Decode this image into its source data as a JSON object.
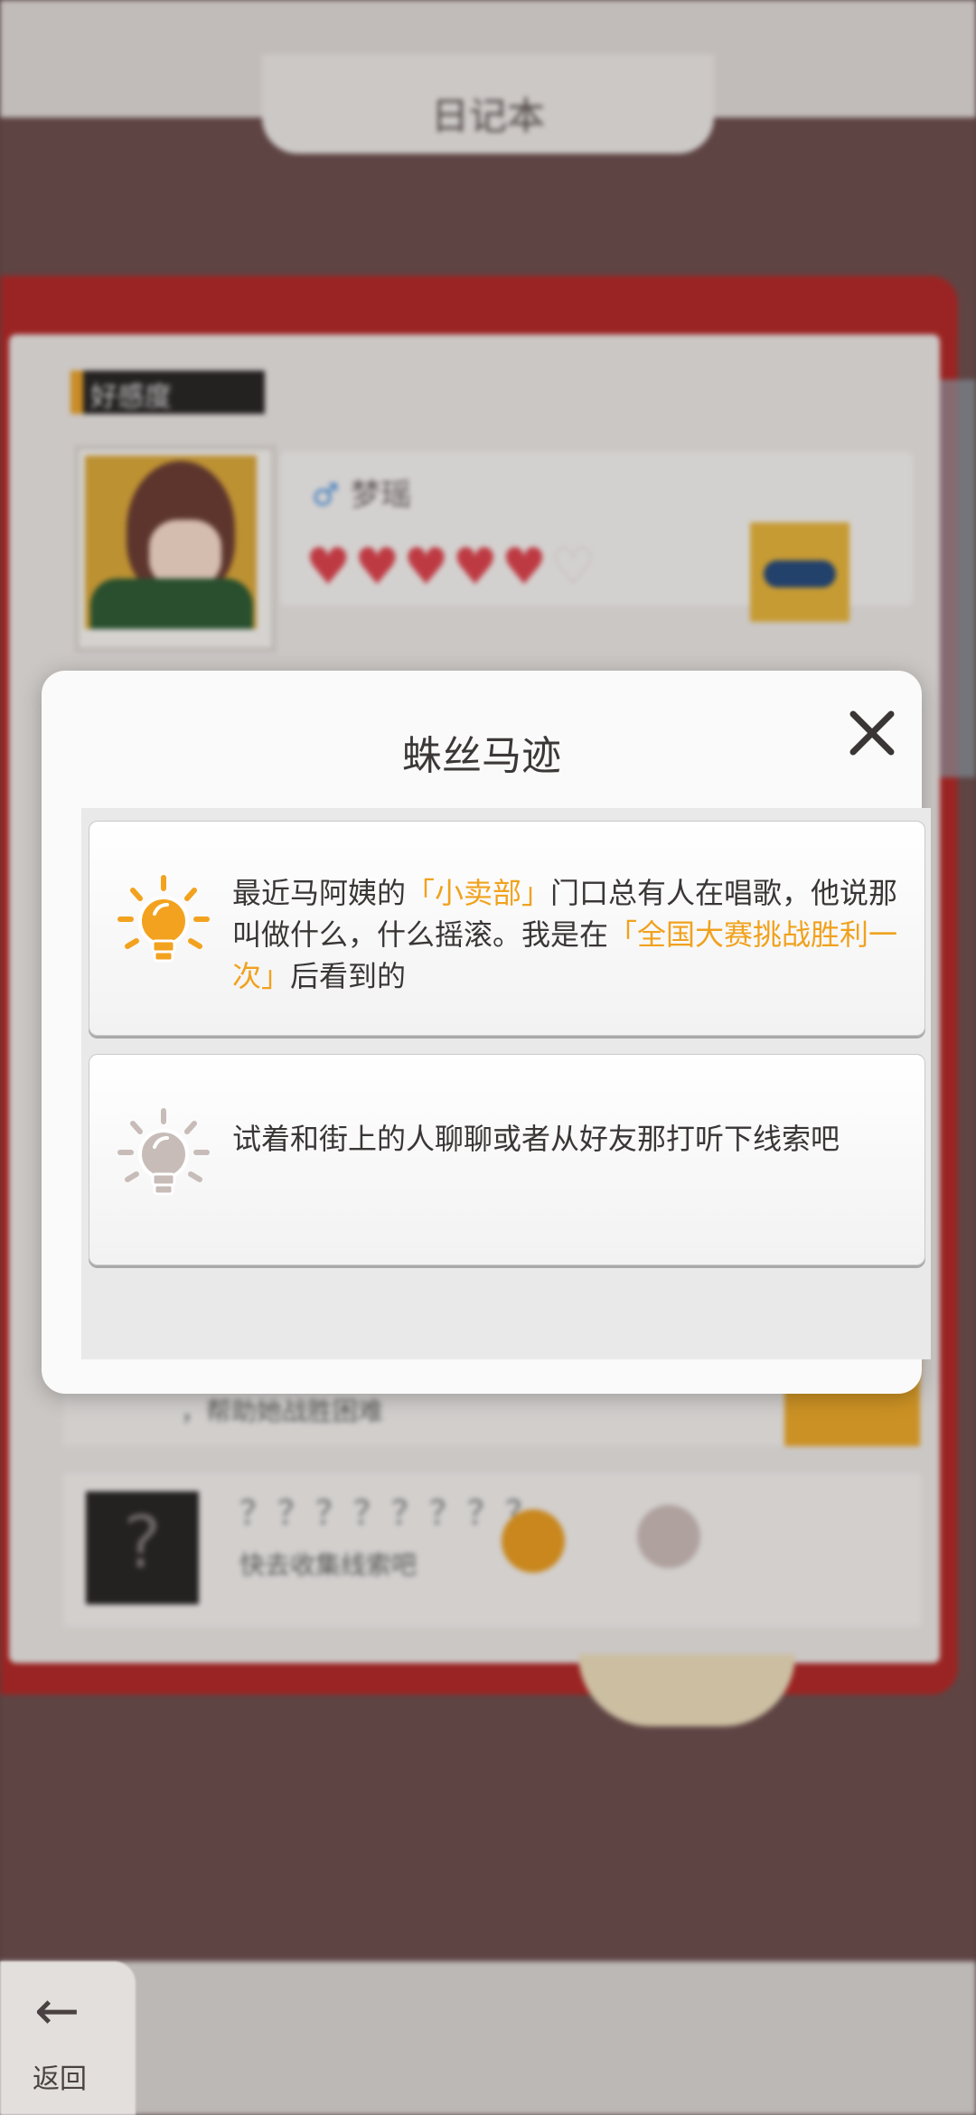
{
  "background": {
    "header_title": "日记本",
    "badge_label": "好感度",
    "character": {
      "name": "梦瑶",
      "gender_symbol": "♂",
      "hearts_filled": "♥♥♥♥♥",
      "hearts_empty": "♡"
    },
    "row2_text": "，帮助她战胜困难",
    "row3": {
      "question_mark": "?",
      "title": "？？？？？？？？",
      "subtitle": "快去收集线索吧"
    }
  },
  "back_button": {
    "arrow": "←",
    "label": "返回"
  },
  "modal": {
    "title": "蛛丝马迹",
    "hints": [
      {
        "status": "unlocked",
        "segments": [
          {
            "text": "最近马阿姨的",
            "highlight": false
          },
          {
            "text": "「小卖部」",
            "highlight": true
          },
          {
            "text": "门口总有人在唱歌，他说那叫做什么，什么摇滚。我是在",
            "highlight": false
          },
          {
            "text": "「全国大赛挑战胜利一次」",
            "highlight": true
          },
          {
            "text": "后看到的",
            "highlight": false
          }
        ]
      },
      {
        "status": "locked",
        "segments": [
          {
            "text": "试着和街上的人聊聊或者从好友那打听下线索吧",
            "highlight": false
          }
        ]
      }
    ]
  },
  "colors": {
    "highlight": "#f0a21e",
    "bulb_on": "#f3a21f",
    "bulb_off": "#c8bcb9",
    "heart": "#d9434d"
  },
  "icons": {
    "close": "close-icon",
    "back": "back-arrow-icon",
    "bulb_on": "lightbulb-on-icon",
    "bulb_off": "lightbulb-off-icon"
  }
}
